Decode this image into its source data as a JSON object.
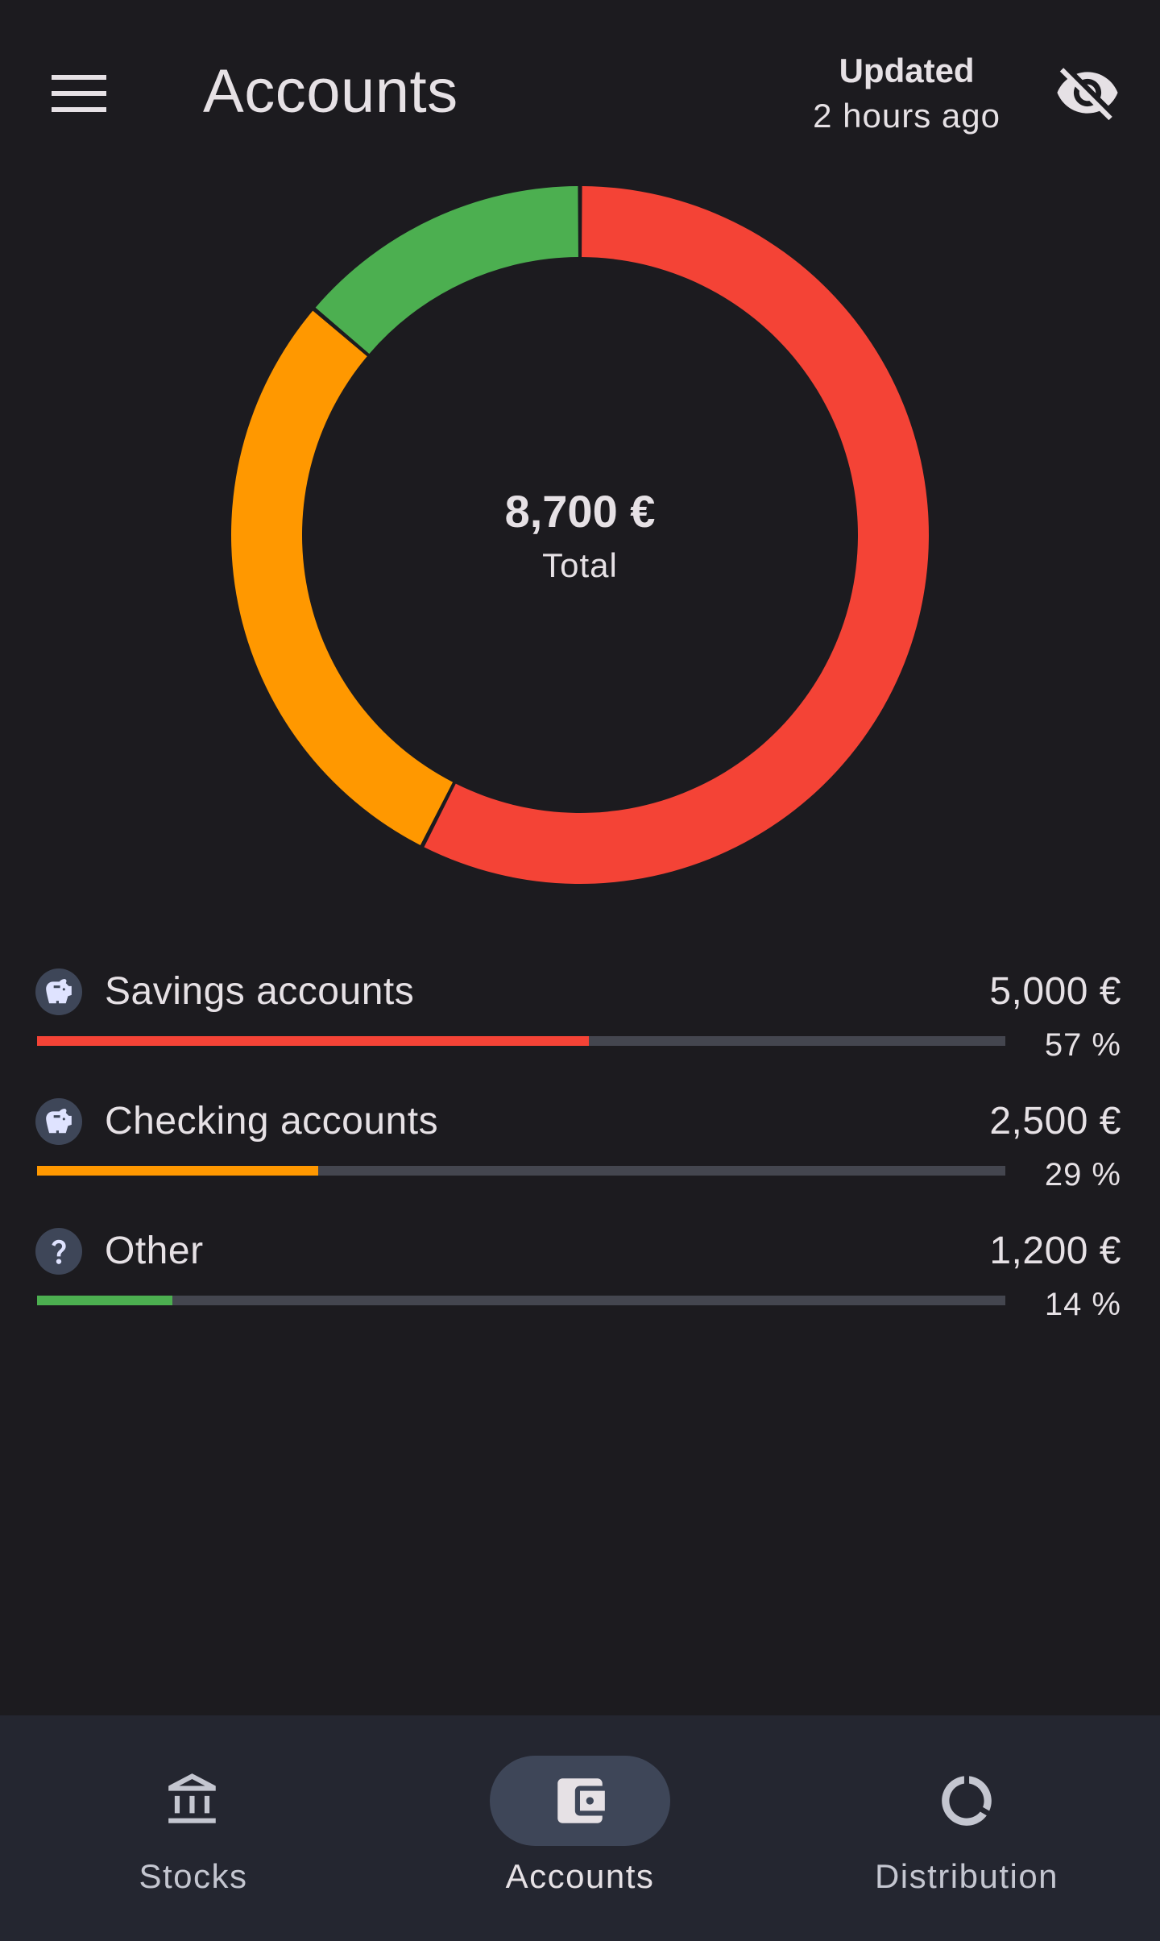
{
  "header": {
    "title": "Accounts",
    "updated_label": "Updated",
    "updated_time": "2 hours ago",
    "menu_icon": "menu-icon",
    "visibility_icon": "eye-off-icon"
  },
  "summary": {
    "total_value": "8,700 €",
    "total_label": "Total"
  },
  "chart_data": {
    "type": "pie",
    "categories": [
      "Savings accounts",
      "Checking accounts",
      "Other"
    ],
    "values": [
      5000,
      2500,
      1200
    ],
    "colors": [
      "#f44336",
      "#ff9800",
      "#4caf50"
    ],
    "center_text": "8,700 €",
    "center_label": "Total"
  },
  "accounts": [
    {
      "name": "Savings accounts",
      "amount": "5,000 €",
      "percent": "57 %",
      "share": 0.57,
      "color": "#f44336",
      "icon": "piggy-bank-icon"
    },
    {
      "name": "Checking accounts",
      "amount": "2,500 €",
      "percent": "29 %",
      "share": 0.29,
      "color": "#ff9800",
      "icon": "piggy-bank-icon"
    },
    {
      "name": "Other",
      "amount": "1,200 €",
      "percent": "14 %",
      "share": 0.14,
      "color": "#4caf50",
      "icon": "question-icon"
    }
  ],
  "nav": {
    "items": [
      {
        "label": "Stocks",
        "icon": "bank-icon",
        "active": false
      },
      {
        "label": "Accounts",
        "icon": "wallet-icon",
        "active": true
      },
      {
        "label": "Distribution",
        "icon": "donut-chart-icon",
        "active": false
      }
    ]
  },
  "colors": {
    "background": "#1c1b1f",
    "nav_background": "#242630",
    "active_pill": "#3e4658",
    "track": "#44464f"
  }
}
